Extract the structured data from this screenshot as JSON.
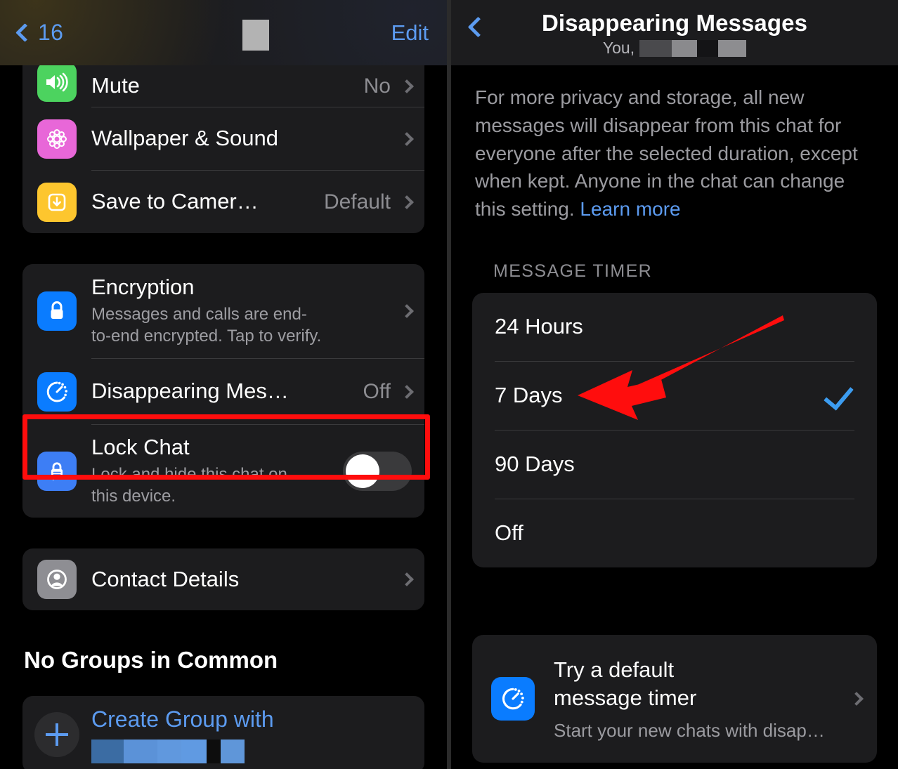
{
  "left_panel": {
    "nav": {
      "back_label": "16",
      "back_icon": "chevron-left-icon",
      "title_redacted": true,
      "edit_label": "Edit"
    },
    "group_settings": {
      "rows": [
        {
          "icon": "speaker-wave-icon",
          "icon_color": "#4cd35f",
          "title": "Mute",
          "value": "No",
          "chevron": true
        },
        {
          "icon": "flower-wallpaper-icon",
          "icon_color": "#e867d8",
          "title": "Wallpaper & Sound",
          "value": "",
          "chevron": true
        },
        {
          "icon": "save-download-icon",
          "icon_color": "#fdc62e",
          "title": "Save to Camer…",
          "value": "Default",
          "chevron": true
        }
      ]
    },
    "privacy_settings": {
      "rows": [
        {
          "icon": "lock-icon",
          "icon_color": "#0a7cff",
          "title": "Encryption",
          "subtitle": "Messages and calls are end-to-end encrypted. Tap to verify.",
          "value": "",
          "chevron": true
        },
        {
          "icon": "disappearing-timer-icon",
          "icon_color": "#0a7cff",
          "title": "Disappearing Mes…",
          "subtitle": "",
          "value": "Off",
          "chevron": true,
          "highlighted": true
        },
        {
          "icon": "lock-chat-icon",
          "icon_color": "#3d7ef5",
          "title": "Lock Chat",
          "subtitle": "Lock and hide this chat on this device.",
          "toggle": {
            "state": "off"
          }
        }
      ]
    },
    "contact_card": {
      "icon": "contact-person-icon",
      "icon_color": "#8e8e93",
      "title": "Contact Details",
      "chevron": true
    },
    "groups_section": {
      "heading": "No Groups in Common",
      "create_group": {
        "plus_icon": "plus-icon",
        "label": "Create Group with",
        "name_redacted": true
      }
    },
    "highlight_color": "#ff0d0d"
  },
  "right_panel": {
    "nav": {
      "back_icon": "chevron-left-icon",
      "title": "Disappearing Messages",
      "subtitle_prefix": "You,",
      "subtitle_redacted": true
    },
    "intro": {
      "text": "For more privacy and storage, all new messages will disappear from this chat for everyone after the selected duration, except when kept. Anyone in the chat can change this setting.",
      "link_label": "Learn more",
      "link_color": "#5c9bf0"
    },
    "timer_section": {
      "label": "MESSAGE TIMER",
      "options": [
        {
          "label": "24 Hours",
          "selected": false
        },
        {
          "label": "7 Days",
          "selected": true
        },
        {
          "label": "90 Days",
          "selected": false
        },
        {
          "label": "Off",
          "selected": false
        }
      ],
      "check_color": "#3c9cf0"
    },
    "default_timer_card": {
      "icon": "disappearing-timer-icon",
      "icon_color": "#0a7cff",
      "title_line1": "Try a default",
      "title_line2": "message timer",
      "subtitle": "Start your new chats with disap…",
      "chevron": true
    },
    "annotation": {
      "type": "arrow",
      "color": "#ff0d0d",
      "points_to": "7 Days"
    }
  }
}
